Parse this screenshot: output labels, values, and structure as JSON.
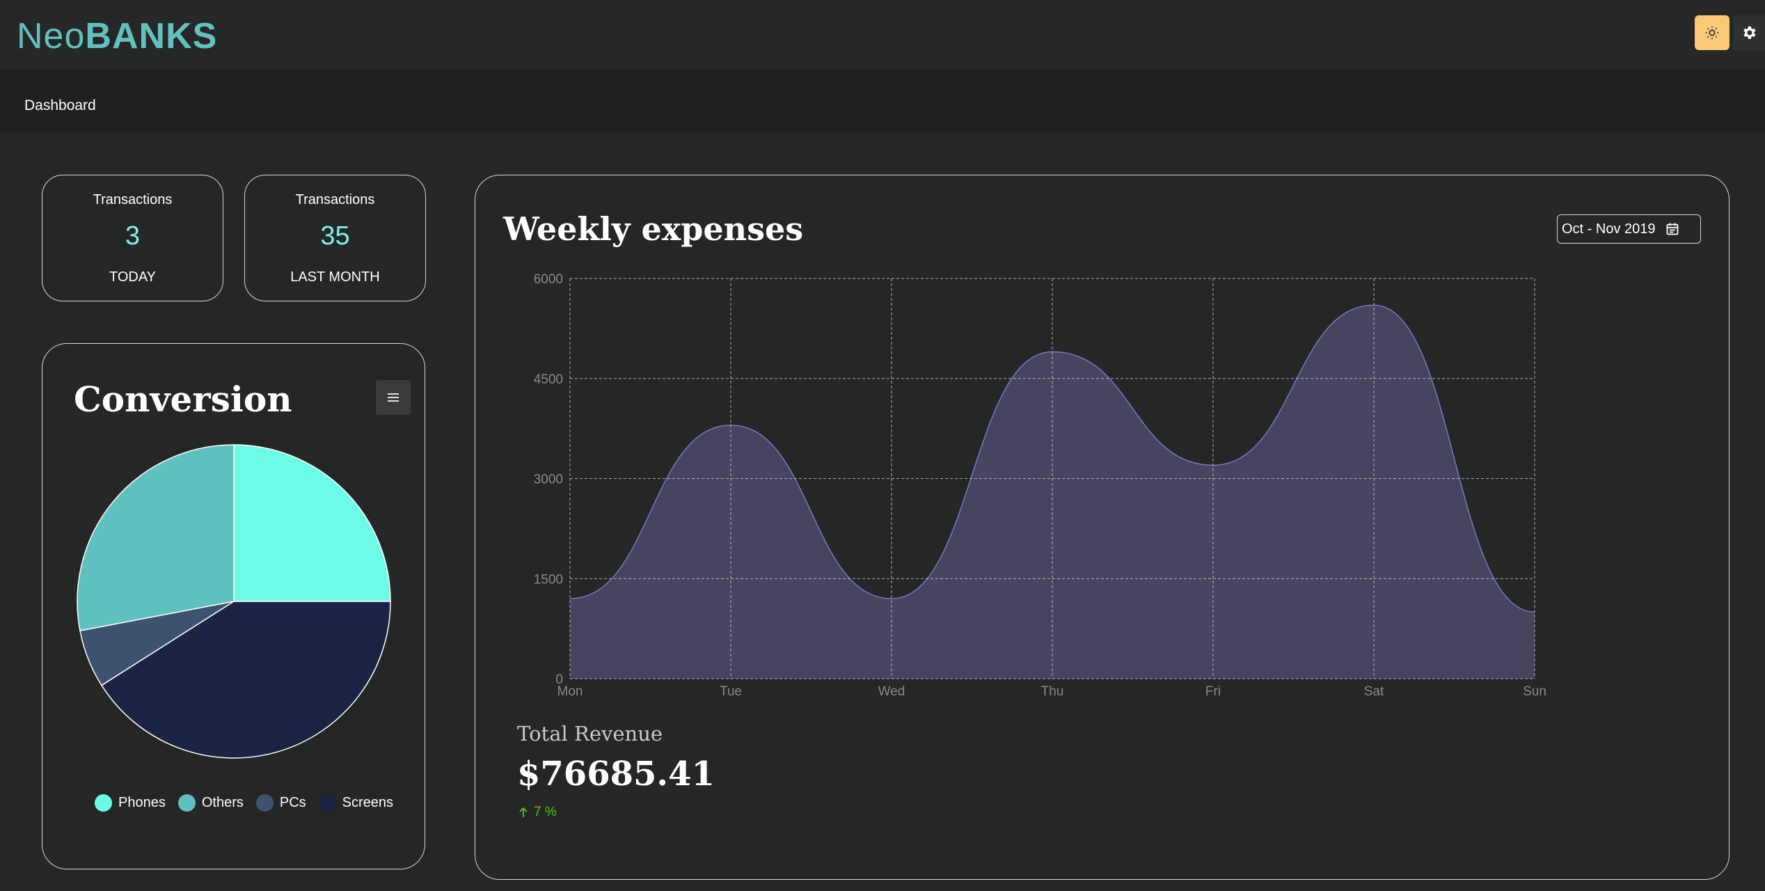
{
  "brand": {
    "logo_light": "Neo",
    "logo_bold": "BANKS"
  },
  "header": {
    "theme_toggle_icon": "sun-icon",
    "settings_icon": "gear-icon"
  },
  "breadcrumb": {
    "current": "Dashboard"
  },
  "stats": [
    {
      "label": "Transactions",
      "value": "3",
      "period": "TODAY"
    },
    {
      "label": "Transactions",
      "value": "35",
      "period": "LAST MONTH"
    }
  ],
  "conversion": {
    "title": "Conversion",
    "menu_icon": "hamburger-icon",
    "chart_data": {
      "type": "pie",
      "categories": [
        "Phones",
        "Others",
        "PCs",
        "Screens"
      ],
      "values": [
        25,
        28,
        6,
        41
      ],
      "colors": [
        "#6cfbe7",
        "#5fc1bf",
        "#3d5270",
        "#1b2444"
      ]
    }
  },
  "weekly": {
    "title": "Weekly expenses",
    "date_range": "Oct - Nov 2019",
    "calendar_icon": "calendar-icon",
    "chart_data": {
      "type": "area",
      "categories": [
        "Mon",
        "Tue",
        "Wed",
        "Thu",
        "Fri",
        "Sat",
        "Sun"
      ],
      "series": [
        {
          "values": [
            1200,
            3800,
            1200,
            4900,
            3200,
            5600,
            1000
          ]
        }
      ],
      "ylim": [
        0,
        6000
      ],
      "yticks": [
        "0",
        "1500",
        "3000",
        "4500",
        "6000"
      ],
      "grid": true,
      "color": "#7b77c9"
    },
    "total_revenue_label": "Total Revenue",
    "total_revenue_value": "$76685.41",
    "change": "7 %",
    "change_icon": "arrow-up-icon"
  }
}
